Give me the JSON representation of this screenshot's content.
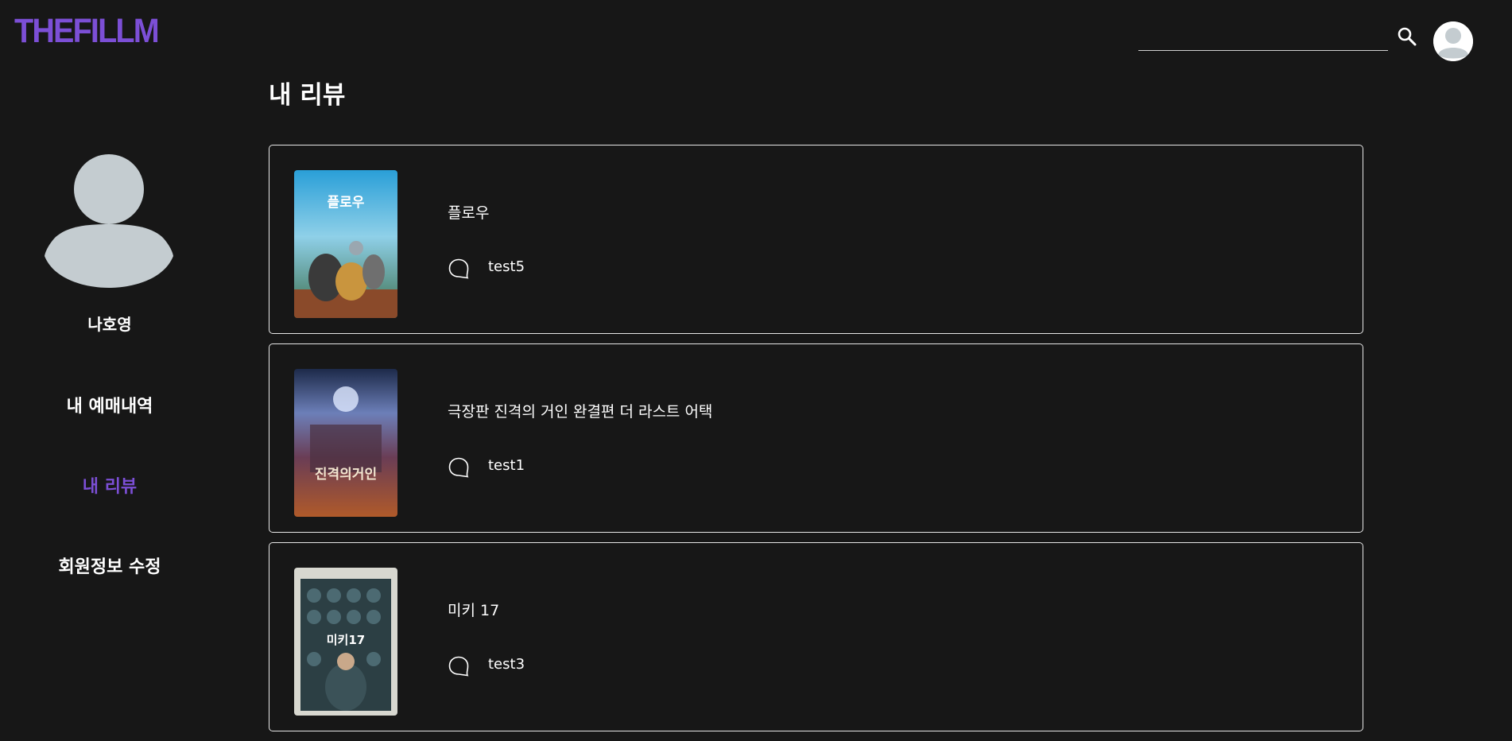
{
  "brand": {
    "logo_text": "THEFILLM",
    "accent_color": "#7c4fd6"
  },
  "header": {
    "search": {
      "value": "",
      "placeholder": "",
      "icon": "search-icon"
    },
    "avatar_icon": "user-avatar-icon"
  },
  "sidebar": {
    "user_name": "나호영",
    "avatar_icon": "user-avatar-icon",
    "menu": [
      {
        "label": "내 예매내역",
        "active": false
      },
      {
        "label": "내 리뷰",
        "active": true
      },
      {
        "label": "회원정보 수정",
        "active": false
      }
    ]
  },
  "main": {
    "title": "내 리뷰",
    "reviews": [
      {
        "movie_title": "플로우",
        "comment": "test5",
        "poster_text": "플로우"
      },
      {
        "movie_title": "극장판 진격의 거인 완결편 더 라스트 어택",
        "comment": "test1",
        "poster_text": "진격의거인"
      },
      {
        "movie_title": "미키 17",
        "comment": "test3",
        "poster_text": "미키17"
      }
    ]
  },
  "colors": {
    "background": "#171717",
    "card_border": "#e6e6e6",
    "avatar_gray": "#c4ccd0"
  }
}
